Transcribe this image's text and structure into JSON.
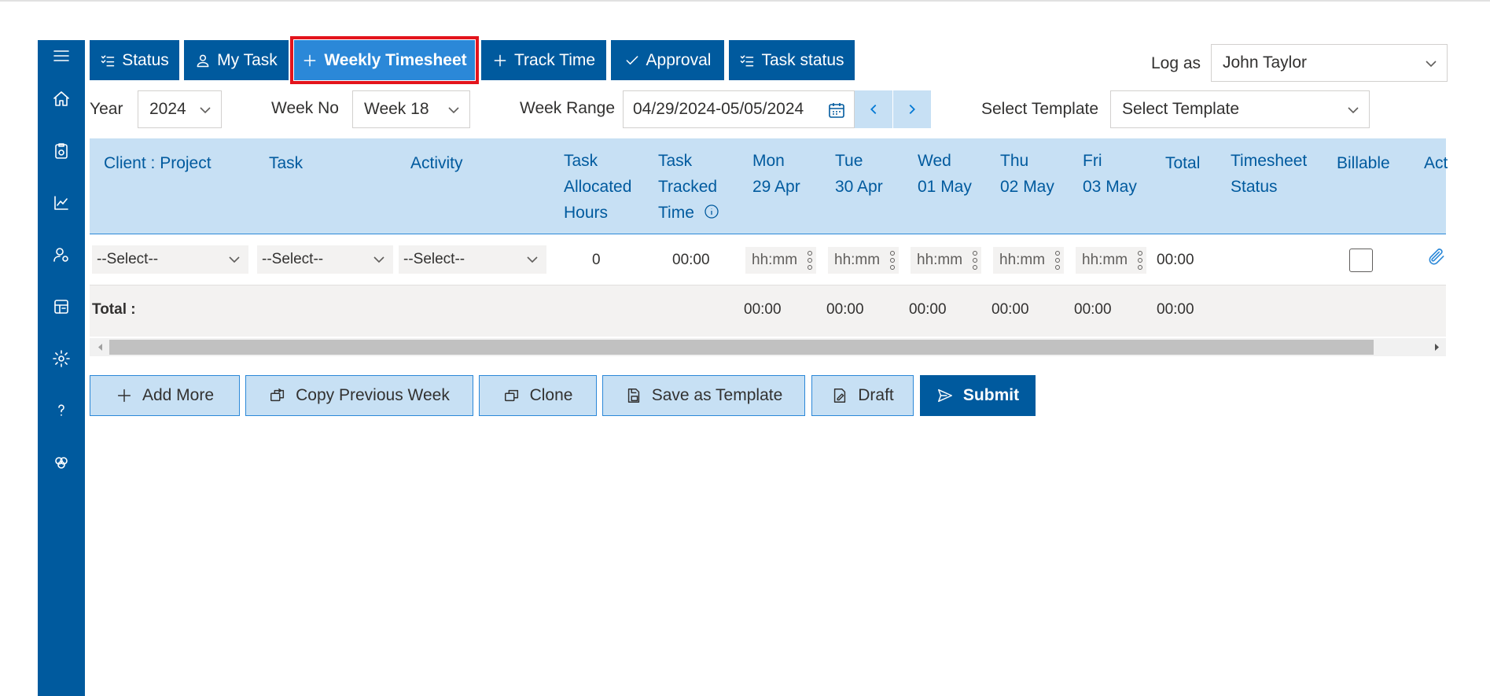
{
  "tabs": [
    {
      "label": "Status",
      "icon": "checklist-icon"
    },
    {
      "label": "My Task",
      "icon": "user-icon"
    },
    {
      "label": "Weekly Timesheet",
      "icon": "plus-icon",
      "active": true
    },
    {
      "label": "Track Time",
      "icon": "plus-icon"
    },
    {
      "label": "Approval",
      "icon": "check-icon"
    },
    {
      "label": "Task status",
      "icon": "checklist-icon"
    }
  ],
  "log_as": {
    "label": "Log as",
    "value": "John Taylor"
  },
  "filters": {
    "year_label": "Year",
    "year_value": "2024",
    "week_label": "Week No",
    "week_value": "Week 18",
    "range_label": "Week Range",
    "range_value": "04/29/2024-05/05/2024",
    "template_label": "Select Template",
    "template_value": "Select Template"
  },
  "columns": {
    "client_project": "Client : Project",
    "task": "Task",
    "activity": "Activity",
    "allocated": [
      "Task",
      "Allocated",
      "Hours"
    ],
    "tracked": [
      "Task",
      "Tracked",
      "Time"
    ],
    "mon": [
      "Mon",
      "29 Apr"
    ],
    "tue": [
      "Tue",
      "30 Apr"
    ],
    "wed": [
      "Wed",
      "01 May"
    ],
    "thu": [
      "Thu",
      "02 May"
    ],
    "fri": [
      "Fri",
      "03 May"
    ],
    "total": "Total",
    "status": [
      "Timesheet",
      "Status"
    ],
    "billable": "Billable",
    "action": "Act"
  },
  "row": {
    "client_select": "--Select--",
    "task_select": "--Select--",
    "activity_select": "--Select--",
    "allocated": "0",
    "tracked": "00:00",
    "time_placeholder": "hh:mm",
    "total": "00:00",
    "billable": false
  },
  "totals": {
    "label": "Total :",
    "mon": "00:00",
    "tue": "00:00",
    "wed": "00:00",
    "thu": "00:00",
    "fri": "00:00",
    "total": "00:00"
  },
  "actions": {
    "add_more": "Add More",
    "copy_previous": "Copy Previous Week",
    "clone": "Clone",
    "save_template": "Save as Template",
    "draft": "Draft",
    "submit": "Submit"
  },
  "sidebar": [
    "menu-icon",
    "home-icon",
    "timesheet-icon",
    "chart-icon",
    "user-settings-icon",
    "board-icon",
    "gear-icon",
    "help-icon",
    "integrations-icon"
  ]
}
